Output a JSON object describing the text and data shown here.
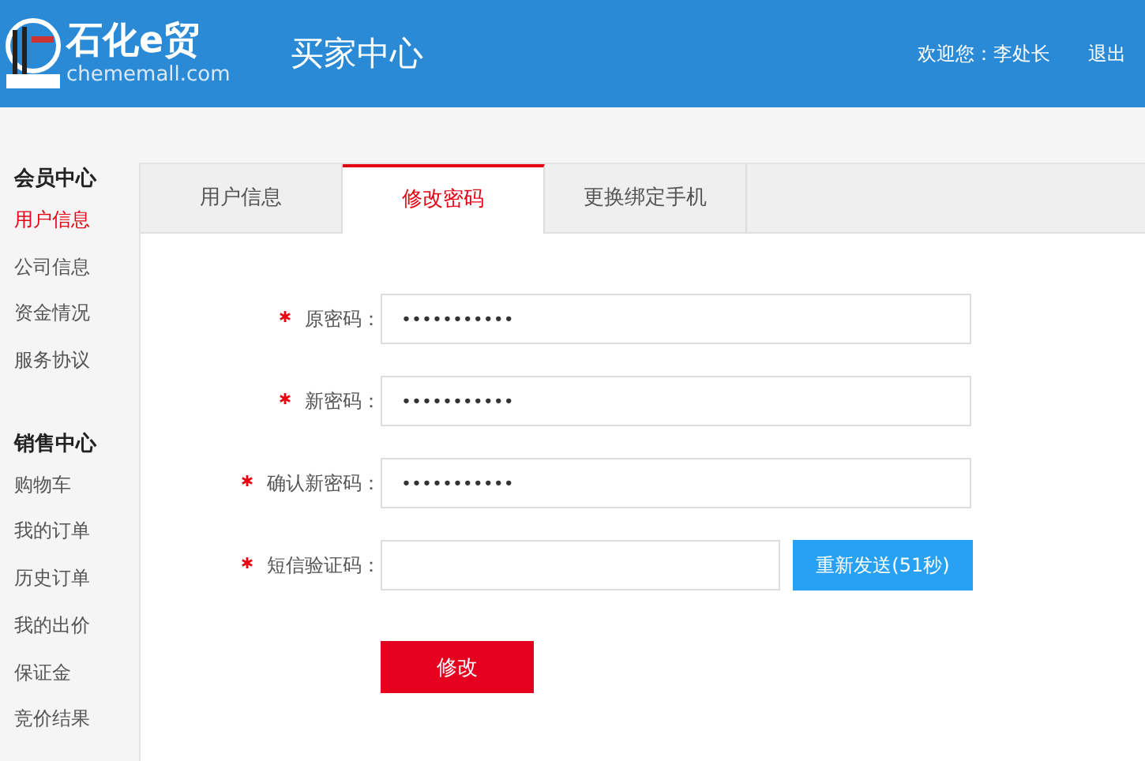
{
  "header": {
    "logo_name": "石化e贸",
    "logo_domain": "chememall.com",
    "title": "买家中心",
    "welcome": "欢迎您：李处长",
    "logout": "退出"
  },
  "sidebar": [
    {
      "title": "会员中心",
      "items": [
        {
          "label": "用户信息",
          "selected": true
        },
        {
          "label": "公司信息",
          "selected": false
        },
        {
          "label": "资金情况",
          "selected": false
        },
        {
          "label": "服务协议",
          "selected": false
        }
      ]
    },
    {
      "title": "销售中心",
      "items": [
        {
          "label": "购物车",
          "selected": false
        },
        {
          "label": "我的订单",
          "selected": false
        },
        {
          "label": "历史订单",
          "selected": false
        },
        {
          "label": "我的出价",
          "selected": false
        },
        {
          "label": "保证金",
          "selected": false
        },
        {
          "label": "竞价结果",
          "selected": false
        }
      ]
    }
  ],
  "tabs": [
    {
      "label": "用户信息",
      "selected": false
    },
    {
      "label": "修改密码",
      "selected": true
    },
    {
      "label": "更换绑定手机",
      "selected": false
    }
  ],
  "form": {
    "fields": [
      {
        "label": "原密码：",
        "required": true,
        "value": "•••••••••••"
      },
      {
        "label": "新密码：",
        "required": true,
        "value": "•••••••••••"
      },
      {
        "label": "确认新密码：",
        "required": true,
        "value": "•••••••••••"
      },
      {
        "label": "短信验证码：",
        "required": true,
        "resend": "重新发送(51秒)"
      }
    ],
    "submit": "修改"
  }
}
